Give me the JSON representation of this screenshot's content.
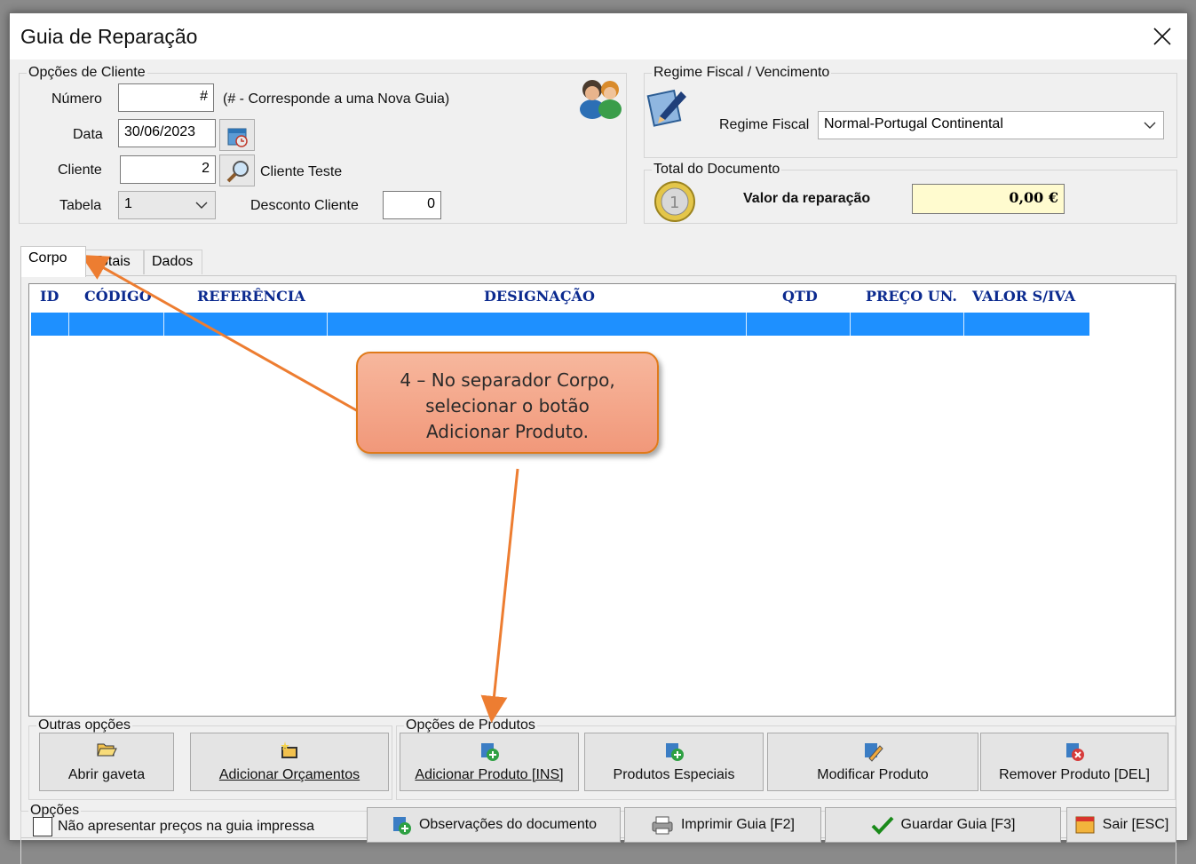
{
  "window": {
    "title": "Guia de Reparação"
  },
  "client_options": {
    "legend": "Opções de Cliente",
    "numero_label": "Número",
    "numero_value": "#",
    "numero_hint": "(# - Corresponde a uma Nova Guia)",
    "data_label": "Data",
    "data_value": "30/06/2023",
    "cliente_label": "Cliente",
    "cliente_value": "2",
    "cliente_name": "Cliente Teste",
    "tabela_label": "Tabela",
    "tabela_value": "1",
    "desconto_label": "Desconto Cliente",
    "desconto_value": "0"
  },
  "fiscal": {
    "legend": "Regime Fiscal / Vencimento",
    "regime_label": "Regime Fiscal",
    "regime_value": "Normal-Portugal Continental"
  },
  "total": {
    "legend": "Total do Documento",
    "valor_label": "Valor da reparação",
    "valor_value": "0,00 €"
  },
  "tabs": [
    {
      "label": "Corpo",
      "active": true
    },
    {
      "label": "Totais",
      "active": false
    },
    {
      "label": "Dados",
      "active": false
    }
  ],
  "grid": {
    "columns": [
      "ID",
      "CÓDIGO",
      "REFERÊNCIA",
      "DESIGNAÇÃO",
      "QTD",
      "PREÇO UN.",
      "VALOR S/IVA"
    ],
    "selected_row_color": "#1e90ff"
  },
  "other_options": {
    "legend": "Outras opções",
    "buttons": [
      "Abrir gaveta",
      "Adicionar Orçamentos"
    ]
  },
  "product_options": {
    "legend": "Opções de Produtos",
    "buttons": [
      "Adicionar Produto [INS]",
      "Produtos Especiais",
      "Modificar Produto",
      "Remover Produto [DEL]"
    ]
  },
  "options": {
    "legend": "Opções",
    "checkbox_label": "Não apresentar preços na guia impressa",
    "checkbox_checked": false
  },
  "footer_buttons": [
    "Observações do documento",
    "Imprimir Guia [F2]",
    "Guardar Guia [F3]",
    "Sair [ESC]"
  ],
  "annotation": {
    "text": "4 – No separador Corpo, selecionar o botão Adicionar Produto.",
    "color": "#f1987a"
  }
}
